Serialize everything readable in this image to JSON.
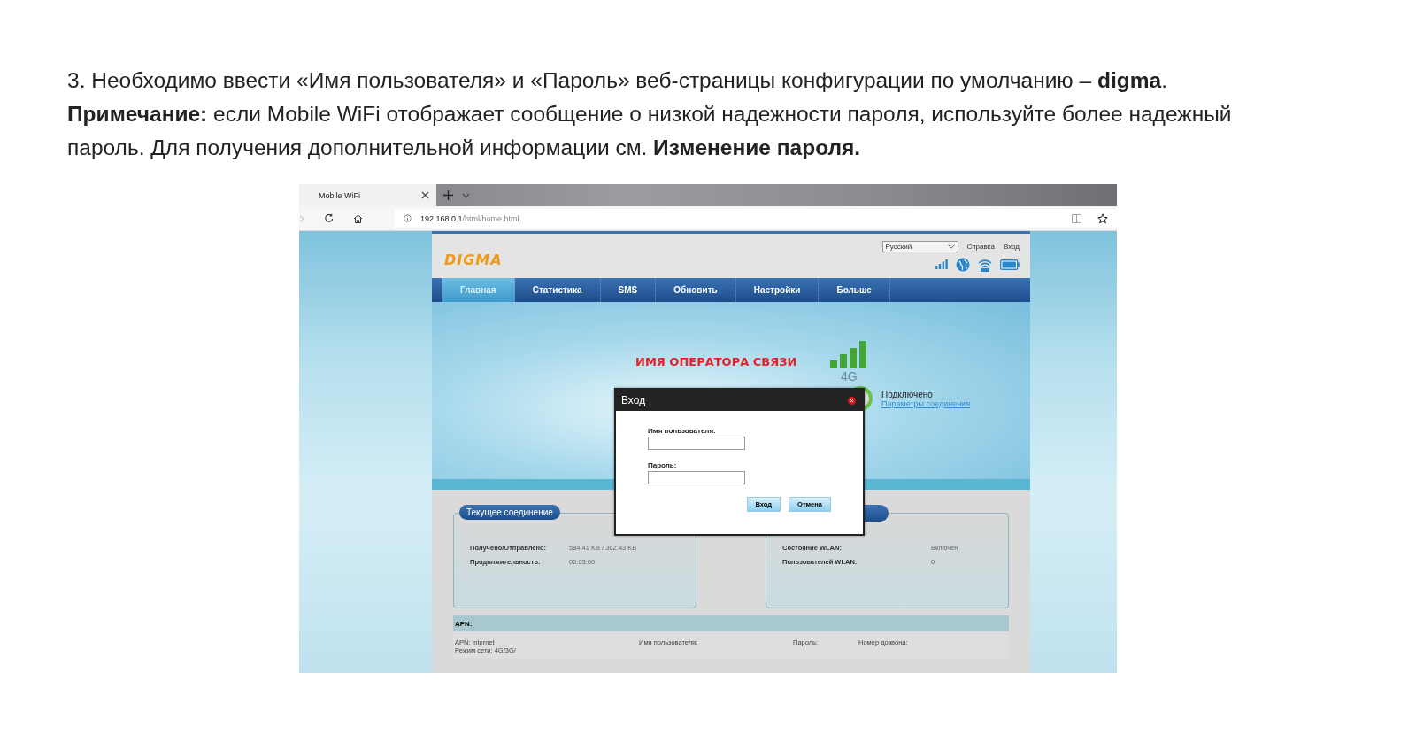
{
  "instructions": {
    "paragraphs": [
      "3. Необходимо ввести «Имя пользователя» и «Пароль» веб-страницы конфигурации по умолчанию – **digma**.",
      "**Примечание:** если Mobile WiFi отображает сообщение о низкой надежности пароля, используйте более надежный пароль. Для получения дополнительной информации см. **Изменение пароля.**"
    ]
  },
  "browser": {
    "tab_title": "Mobile WiFi",
    "url_host": "192.168.0.1",
    "url_path": "/html/home.html"
  },
  "router": {
    "logo": "DIGMA",
    "language": "Русский",
    "help_link": "Справка",
    "login_link": "Вход",
    "nav": [
      {
        "label": "Главная",
        "selected": true
      },
      {
        "label": "Статистика",
        "selected": false
      },
      {
        "label": "SMS",
        "selected": false
      },
      {
        "label": "Обновить",
        "selected": false
      },
      {
        "label": "Настройки",
        "selected": false
      },
      {
        "label": "Больше",
        "selected": false
      }
    ],
    "operator_name": "ИМЯ ОПЕРАТОРА СВЯЗИ",
    "network_type": "4G",
    "connection_status": "Подключено",
    "connection_settings_link": "Параметры соединения",
    "current_connection": {
      "title": "Текущее соединение",
      "rows": [
        {
          "label": "Получено/Отправлено:",
          "value": "584.41 KB / 362.43 KB"
        },
        {
          "label": "Продолжительность:",
          "value": "00:03:00"
        }
      ]
    },
    "wlan": {
      "rows": [
        {
          "label": "Состояние WLAN:",
          "value": "Включен"
        },
        {
          "label": "Пользователей WLAN:",
          "value": "0"
        }
      ]
    },
    "apn": {
      "title": "APN:",
      "apn": "APN: internet",
      "network_mode": "Режим сети: 4G/3G/",
      "username_label": "Имя пользователя:",
      "password_label": "Пароль:",
      "dial_number_label": "Номер дозвона:"
    }
  },
  "login_dialog": {
    "title": "Вход",
    "username_label": "Имя пользователя:",
    "password_label": "Пароль:",
    "buttons": [
      "Вход",
      "Отмена"
    ]
  }
}
